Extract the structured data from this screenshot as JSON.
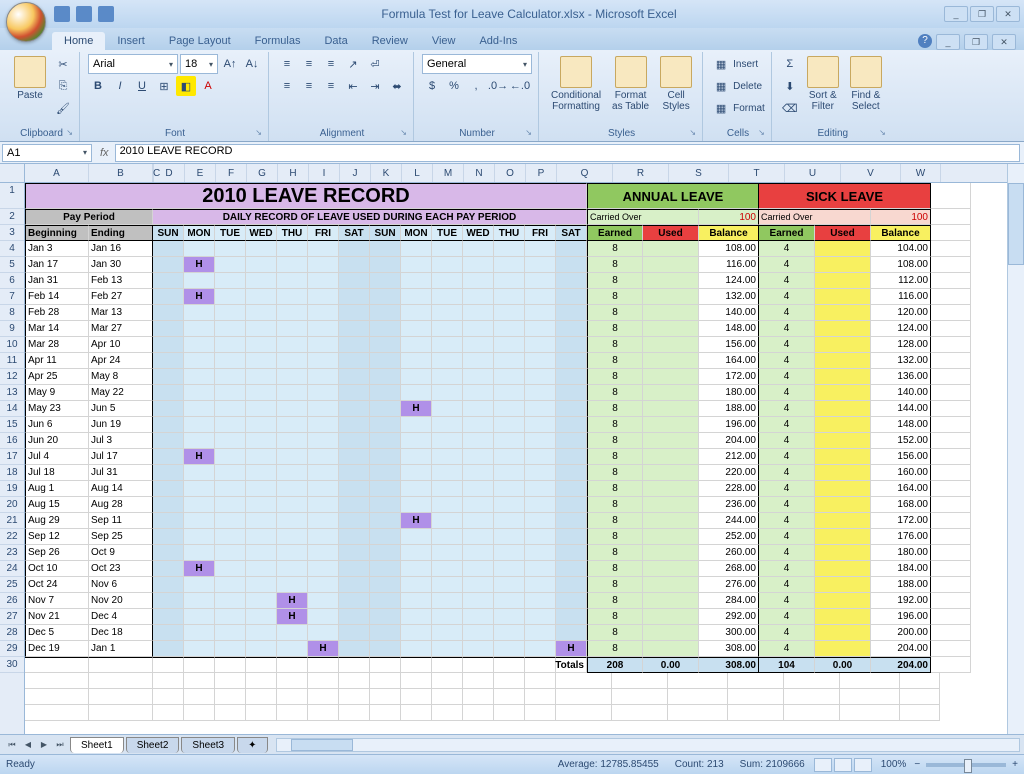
{
  "title": "Formula Test for Leave Calculator.xlsx - Microsoft Excel",
  "tabs": [
    "Home",
    "Insert",
    "Page Layout",
    "Formulas",
    "Data",
    "Review",
    "View",
    "Add-Ins"
  ],
  "active_tab": "Home",
  "ribbon": {
    "clipboard": {
      "label": "Clipboard",
      "paste": "Paste"
    },
    "font": {
      "label": "Font",
      "name": "Arial",
      "size": "18"
    },
    "alignment": {
      "label": "Alignment"
    },
    "number": {
      "label": "Number",
      "fmt": "General"
    },
    "styles": {
      "label": "Styles",
      "cond": "Conditional\nFormatting",
      "table": "Format\nas Table",
      "cell": "Cell\nStyles"
    },
    "cells": {
      "label": "Cells",
      "insert": "Insert",
      "delete": "Delete",
      "format": "Format"
    },
    "editing": {
      "label": "Editing",
      "sort": "Sort &\nFilter",
      "find": "Find &\nSelect"
    }
  },
  "namebox": "A1",
  "formula": "2010 LEAVE RECORD",
  "columns": [
    "A",
    "B",
    "C",
    "D",
    "E",
    "F",
    "G",
    "H",
    "I",
    "J",
    "K",
    "L",
    "M",
    "N",
    "O",
    "P",
    "Q",
    "R",
    "S",
    "T",
    "U",
    "V",
    "W"
  ],
  "headers": {
    "title": "2010 LEAVE RECORD",
    "subtitle": "DAILY RECORD OF LEAVE USED DURING EACH PAY PERIOD",
    "pay_period": "Pay Period",
    "beginning": "Beginning",
    "ending": "Ending",
    "days": [
      "SUN",
      "MON",
      "TUE",
      "WED",
      "THU",
      "FRI",
      "SAT",
      "SUN",
      "MON",
      "TUE",
      "WED",
      "THU",
      "FRI",
      "SAT"
    ],
    "annual": "ANNUAL LEAVE",
    "sick": "SICK LEAVE",
    "carried": "Carried Over",
    "carried_annual": "100",
    "carried_sick": "100",
    "earned": "Earned",
    "used": "Used",
    "balance": "Balance",
    "totals": "Totals"
  },
  "rows": [
    {
      "n": 4,
      "b": "Jan 3",
      "e": "Jan 16",
      "h": [],
      "ae": "8",
      "ab": "108.00",
      "se": "4",
      "sb": "104.00"
    },
    {
      "n": 5,
      "b": "Jan 17",
      "e": "Jan 30",
      "h": [
        1
      ],
      "ae": "8",
      "ab": "116.00",
      "se": "4",
      "sb": "108.00"
    },
    {
      "n": 6,
      "b": "Jan 31",
      "e": "Feb 13",
      "h": [],
      "ae": "8",
      "ab": "124.00",
      "se": "4",
      "sb": "112.00"
    },
    {
      "n": 7,
      "b": "Feb 14",
      "e": "Feb 27",
      "h": [
        1
      ],
      "ae": "8",
      "ab": "132.00",
      "se": "4",
      "sb": "116.00"
    },
    {
      "n": 8,
      "b": "Feb 28",
      "e": "Mar 13",
      "h": [],
      "ae": "8",
      "ab": "140.00",
      "se": "4",
      "sb": "120.00"
    },
    {
      "n": 9,
      "b": "Mar 14",
      "e": "Mar 27",
      "h": [],
      "ae": "8",
      "ab": "148.00",
      "se": "4",
      "sb": "124.00"
    },
    {
      "n": 10,
      "b": "Mar 28",
      "e": "Apr 10",
      "h": [],
      "ae": "8",
      "ab": "156.00",
      "se": "4",
      "sb": "128.00"
    },
    {
      "n": 11,
      "b": "Apr 11",
      "e": "Apr 24",
      "h": [],
      "ae": "8",
      "ab": "164.00",
      "se": "4",
      "sb": "132.00"
    },
    {
      "n": 12,
      "b": "Apr 25",
      "e": "May 8",
      "h": [],
      "ae": "8",
      "ab": "172.00",
      "se": "4",
      "sb": "136.00"
    },
    {
      "n": 13,
      "b": "May 9",
      "e": "May 22",
      "h": [],
      "ae": "8",
      "ab": "180.00",
      "se": "4",
      "sb": "140.00"
    },
    {
      "n": 14,
      "b": "May 23",
      "e": "Jun 5",
      "h": [
        8
      ],
      "ae": "8",
      "ab": "188.00",
      "se": "4",
      "sb": "144.00"
    },
    {
      "n": 15,
      "b": "Jun 6",
      "e": "Jun 19",
      "h": [],
      "ae": "8",
      "ab": "196.00",
      "se": "4",
      "sb": "148.00"
    },
    {
      "n": 16,
      "b": "Jun 20",
      "e": "Jul 3",
      "h": [],
      "ae": "8",
      "ab": "204.00",
      "se": "4",
      "sb": "152.00"
    },
    {
      "n": 17,
      "b": "Jul 4",
      "e": "Jul 17",
      "h": [
        1
      ],
      "ae": "8",
      "ab": "212.00",
      "se": "4",
      "sb": "156.00"
    },
    {
      "n": 18,
      "b": "Jul 18",
      "e": "Jul 31",
      "h": [],
      "ae": "8",
      "ab": "220.00",
      "se": "4",
      "sb": "160.00"
    },
    {
      "n": 19,
      "b": "Aug 1",
      "e": "Aug 14",
      "h": [],
      "ae": "8",
      "ab": "228.00",
      "se": "4",
      "sb": "164.00"
    },
    {
      "n": 20,
      "b": "Aug 15",
      "e": "Aug 28",
      "h": [],
      "ae": "8",
      "ab": "236.00",
      "se": "4",
      "sb": "168.00"
    },
    {
      "n": 21,
      "b": "Aug 29",
      "e": "Sep 11",
      "h": [
        8
      ],
      "ae": "8",
      "ab": "244.00",
      "se": "4",
      "sb": "172.00"
    },
    {
      "n": 22,
      "b": "Sep 12",
      "e": "Sep 25",
      "h": [],
      "ae": "8",
      "ab": "252.00",
      "se": "4",
      "sb": "176.00"
    },
    {
      "n": 23,
      "b": "Sep 26",
      "e": "Oct 9",
      "h": [],
      "ae": "8",
      "ab": "260.00",
      "se": "4",
      "sb": "180.00"
    },
    {
      "n": 24,
      "b": "Oct 10",
      "e": "Oct 23",
      "h": [
        1
      ],
      "ae": "8",
      "ab": "268.00",
      "se": "4",
      "sb": "184.00"
    },
    {
      "n": 25,
      "b": "Oct 24",
      "e": "Nov 6",
      "h": [],
      "ae": "8",
      "ab": "276.00",
      "se": "4",
      "sb": "188.00"
    },
    {
      "n": 26,
      "b": "Nov 7",
      "e": "Nov 20",
      "h": [
        4
      ],
      "ae": "8",
      "ab": "284.00",
      "se": "4",
      "sb": "192.00"
    },
    {
      "n": 27,
      "b": "Nov 21",
      "e": "Dec 4",
      "h": [
        4
      ],
      "ae": "8",
      "ab": "292.00",
      "se": "4",
      "sb": "196.00"
    },
    {
      "n": 28,
      "b": "Dec 5",
      "e": "Dec 18",
      "h": [],
      "ae": "8",
      "ab": "300.00",
      "se": "4",
      "sb": "200.00"
    },
    {
      "n": 29,
      "b": "Dec 19",
      "e": "Jan 1",
      "h": [
        5,
        13
      ],
      "ae": "8",
      "ab": "308.00",
      "se": "4",
      "sb": "204.00"
    }
  ],
  "totals": {
    "ae": "208",
    "au": "0.00",
    "ab": "308.00",
    "se": "104",
    "su": "0.00",
    "sb": "204.00"
  },
  "sheets": [
    "Sheet1",
    "Sheet2",
    "Sheet3"
  ],
  "active_sheet": "Sheet1",
  "status": {
    "ready": "Ready",
    "avg": "Average: 12785.85455",
    "count": "Count: 213",
    "sum": "Sum: 2109666",
    "zoom": "100%"
  }
}
